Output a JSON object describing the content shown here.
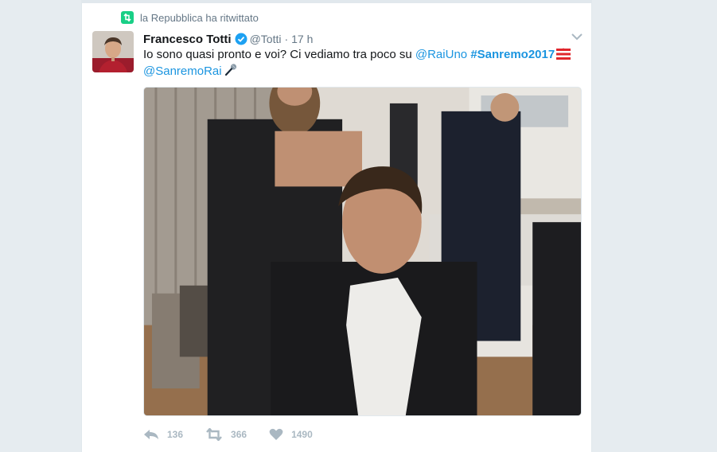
{
  "retweet_context": {
    "text": "la Repubblica ha ritwittato",
    "icon": "retweet-icon"
  },
  "author": {
    "name": "Francesco Totti",
    "handle": "@Totti",
    "separator": "·",
    "time": "17 h",
    "verified": true
  },
  "tweet": {
    "text_intro": "Io sono quasi pronto e voi? Ci vediamo tra poco su ",
    "mention_1": "@RaiUno",
    "hashtag": "#Sanremo2017",
    "mention_2": "@SanremoRai"
  },
  "actions": {
    "reply_count": "136",
    "retweet_count": "366",
    "like_count": "1490"
  },
  "colors": {
    "link": "#1b95e0",
    "retweet_green": "#19cf86",
    "meta_gray": "#657786",
    "action_gray": "#aab8c2",
    "verified_blue": "#1da1f2"
  }
}
